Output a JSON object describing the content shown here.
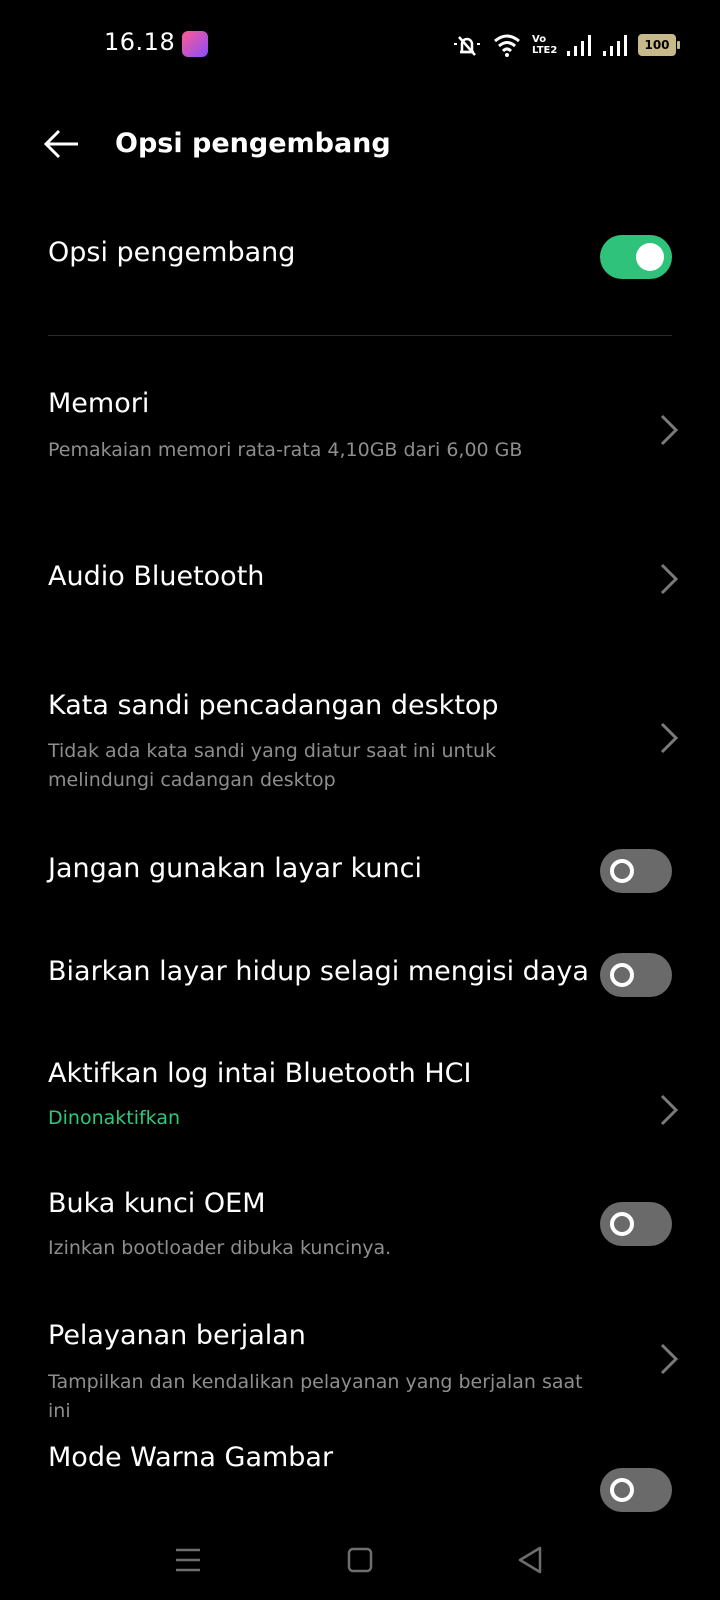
{
  "status_bar": {
    "time": "16.18",
    "volte_label": "Vo LTE2",
    "battery": "100"
  },
  "header": {
    "title": "Opsi pengembang"
  },
  "settings": [
    {
      "title": "Opsi pengembang",
      "control": "toggle",
      "state": "on"
    },
    {
      "title": "Memori",
      "subtitle": "Pemakaian memori rata-rata 4,10GB dari 6,00 GB",
      "control": "chevron"
    },
    {
      "title": "Audio Bluetooth",
      "control": "chevron"
    },
    {
      "title": "Kata sandi pencadangan desktop",
      "subtitle": "Tidak ada kata sandi yang diatur saat ini untuk melindungi cadangan desktop",
      "control": "chevron"
    },
    {
      "title": "Jangan gunakan layar kunci",
      "control": "toggle",
      "state": "off"
    },
    {
      "title": "Biarkan layar hidup selagi mengisi daya",
      "control": "toggle",
      "state": "off"
    },
    {
      "title": "Aktifkan log intai Bluetooth HCI",
      "subtitle": "Dinonaktifkan",
      "control": "chevron"
    },
    {
      "title": "Buka kunci OEM",
      "subtitle": "Izinkan bootloader dibuka kuncinya.",
      "control": "toggle",
      "state": "off"
    },
    {
      "title": "Pelayanan berjalan",
      "subtitle": "Tampilkan dan kendalikan pelayanan yang berjalan saat ini",
      "control": "chevron"
    },
    {
      "title": "Mode Warna Gambar",
      "control": "toggle",
      "state": "off"
    }
  ],
  "colors": {
    "accent_green": "#2fc27a",
    "subtitle_grey": "#8e8e8e",
    "toggle_off": "#6a6a6a",
    "background": "#000000"
  }
}
